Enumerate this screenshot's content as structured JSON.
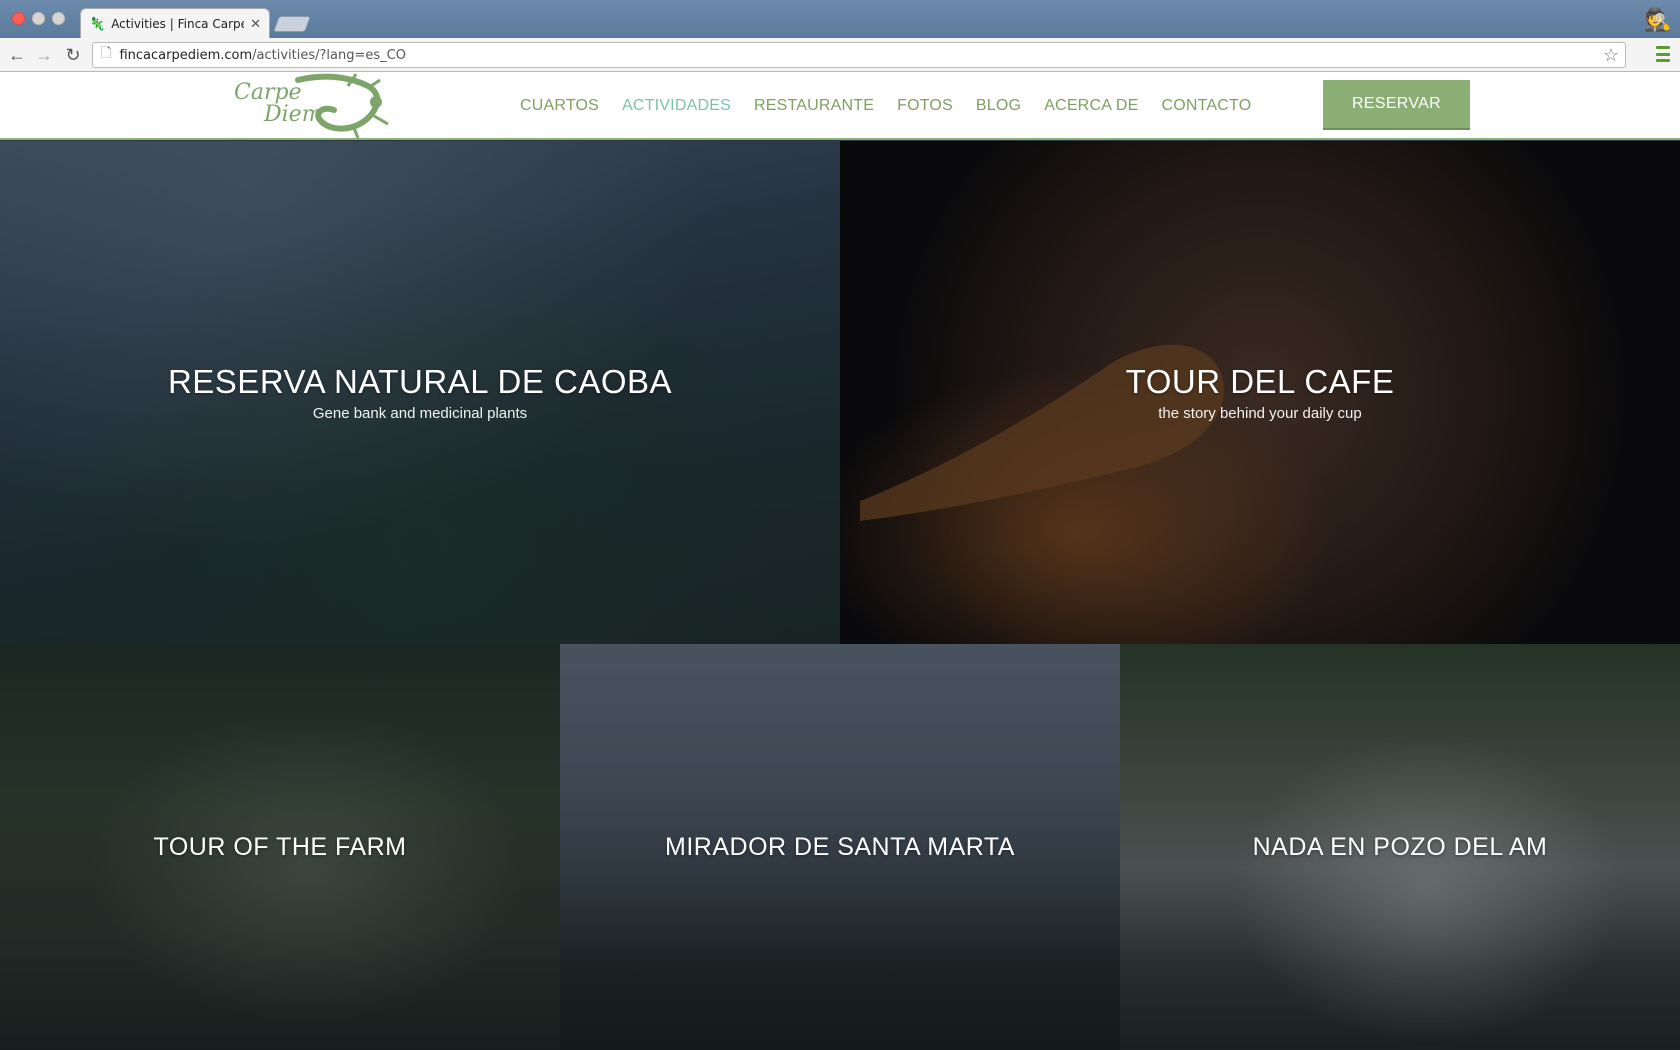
{
  "browser": {
    "tab_title": "Activities | Finca Carpe Diem",
    "url_host": "fincacarpediem.com",
    "url_path": "/activities/?lang=es_CO"
  },
  "site": {
    "logo_line1": "Carpe",
    "logo_line2": "Diem",
    "nav": [
      {
        "label": "CUARTOS",
        "active": false
      },
      {
        "label": "ACTIVIDADES",
        "active": true
      },
      {
        "label": "RESTAURANTE",
        "active": false
      },
      {
        "label": "FOTOS",
        "active": false
      },
      {
        "label": "BLOG",
        "active": false
      },
      {
        "label": "ACERCA DE",
        "active": false
      },
      {
        "label": "CONTACTO",
        "active": false
      }
    ],
    "reserve_label": "RESERVAR",
    "colors": {
      "brand_green": "#8aae73",
      "nav_text": "#7ea060",
      "nav_active": "#7bc3a6"
    }
  },
  "activities": [
    {
      "title": "RESERVA NATURAL DE CAOBA",
      "subtitle": "Gene bank and medicinal plants"
    },
    {
      "title": "TOUR DEL CAFE",
      "subtitle": "the story behind your daily cup"
    },
    {
      "title": "TOUR OF THE FARM",
      "subtitle": ""
    },
    {
      "title": "MIRADOR DE SANTA MARTA",
      "subtitle": ""
    },
    {
      "title": "NADA EN POZO DEL AM",
      "subtitle": ""
    }
  ]
}
